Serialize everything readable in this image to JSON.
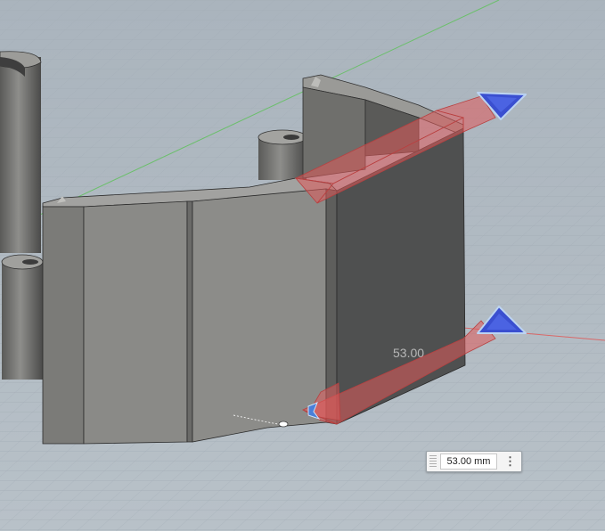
{
  "viewport": {
    "background": "#b2bcc4",
    "grid_color": "#a6b0b8",
    "x_axis_color": "#d96a6a",
    "y_axis_color": "#6ac46a"
  },
  "model": {
    "face_light": "#8a8a86",
    "face_mid": "#6e6e6b",
    "face_dark": "#4e4f4f",
    "top_face": "#a4a4a2",
    "edge": "#2a2a2a"
  },
  "manipulator": {
    "extrude_color": "#e06060",
    "arrow_color": "#3a4fd0",
    "arrow_outline": "#bcd2f0"
  },
  "dimension": {
    "overlay_value": "53.00",
    "input_value": "53.00 mm",
    "menu_icon": "vertical-ellipsis-icon"
  }
}
